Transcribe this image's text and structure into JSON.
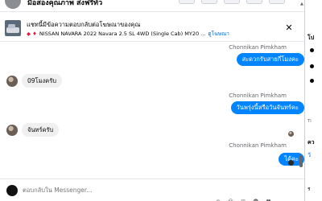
{
  "header": {
    "seller_name": "มือสองคุณภาพ ส่งฟรีทั่ว"
  },
  "product": {
    "title": "แชทนี้มีข้อความตอบกลับต่อโฆษณาของคุณ",
    "subtitle": "NISSAN NAVARA 2022 Navara 2.5 SL 4WD (Single Cab) MY20 ...",
    "view_ad_link": "ดูโฆษณา"
  },
  "messages": [
    {
      "type": "out",
      "sender": "Chonnikan Pimkham",
      "text": "สะดวกรับสายกี่โมงคะ"
    },
    {
      "type": "in",
      "text": "09โมงครับ"
    },
    {
      "type": "out",
      "sender": "Chonnikan Pimkham",
      "text": "วันพรุ่งนี้หรือวันจันทร์คะ"
    },
    {
      "type": "in",
      "text": "จันทร์ครับ"
    },
    {
      "type": "out",
      "sender": "Chonnikan Pimkham",
      "text": "ได้คะ"
    }
  ],
  "composer": {
    "placeholder": "ตอบกลับใน Messenger..."
  },
  "right_panel": {
    "line1": "โป",
    "line2": "Ti",
    "line3": "คว",
    "line4": "วั",
    "line5": "ร"
  },
  "colors": {
    "outgoing_bubble": "#0084ff",
    "incoming_bubble": "#f0f0f0",
    "link": "#0064d1"
  }
}
